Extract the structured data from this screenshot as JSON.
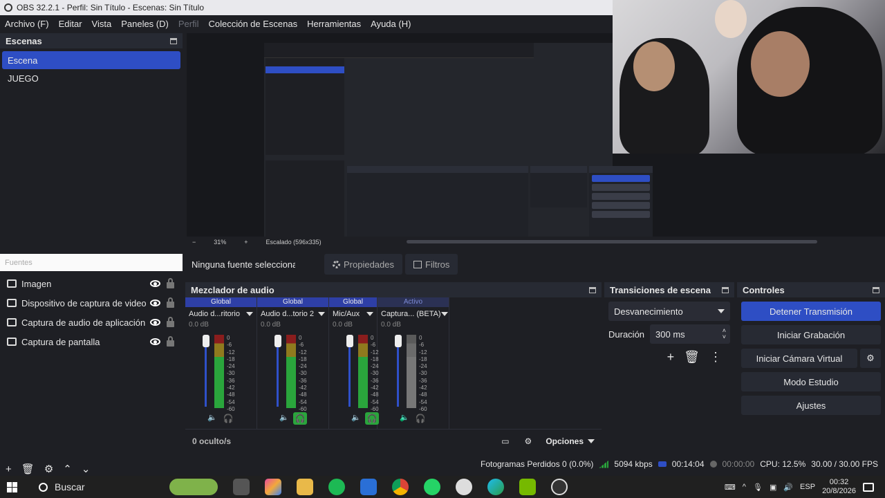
{
  "window": {
    "title": "OBS 32.2.1 - Perfil: Sin Título - Escenas: Sin Título"
  },
  "menu": [
    "Archivo (F)",
    "Editar",
    "Vista",
    "Paneles (D)",
    "Perfil",
    "Colección de Escenas",
    "Herramientas",
    "Ayuda (H)"
  ],
  "scenes": {
    "title": "Escenas",
    "items": [
      "Escena",
      "JUEGO"
    ],
    "selected": 0
  },
  "sources": {
    "title": "Fuentes",
    "items": [
      "Imagen",
      "Dispositivo de captura de video",
      "Captura de audio de aplicación",
      "Captura de pantalla"
    ]
  },
  "preview": {
    "zoom": "31%",
    "scale_label": "Escalado (596x335)"
  },
  "context": {
    "no_source": "Ninguna fuente seleccionada",
    "properties": "Propiedades",
    "filters": "Filtros"
  },
  "mixer": {
    "title": "Mezclador de audio",
    "channels": [
      {
        "header": "Global",
        "name": "Audio d...ritorio",
        "db": "0.0 dB",
        "monitor": false,
        "muted": false,
        "active": true
      },
      {
        "header": "Global",
        "name": "Audio d...torio 2",
        "db": "0.0 dB",
        "monitor": true,
        "muted": false,
        "active": true
      },
      {
        "header": "Global",
        "name": "Mic/Aux",
        "db": "0.0 dB",
        "monitor": true,
        "muted": false,
        "active": true
      },
      {
        "header": "Activo",
        "name": "Captura... (BETA)",
        "db": "0.0 dB",
        "monitor": false,
        "muted": true,
        "active": false
      }
    ],
    "scale": [
      "0",
      "-6",
      "-12",
      "-18",
      "-24",
      "-30",
      "-36",
      "-42",
      "-48",
      "-54",
      "-60"
    ],
    "hidden": "0 oculto/s",
    "options": "Opciones"
  },
  "transitions": {
    "title": "Transiciones de escena",
    "selected": "Desvanecimiento",
    "duration_label": "Duración",
    "duration_value": "300 ms"
  },
  "controls": {
    "title": "Controles",
    "stop_stream": "Detener Transmisión",
    "start_recording": "Iniciar Grabación",
    "virtual_cam": "Iniciar Cámara Virtual",
    "studio_mode": "Modo Estudio",
    "settings": "Ajustes"
  },
  "status": {
    "dropped": "Fotogramas Perdidos 0 (0.0%)",
    "bitrate": "5094 kbps",
    "live_time": "00:14:04",
    "rec_time": "00:00:00",
    "cpu": "CPU: 12.5%",
    "fps": "30.00 / 30.00 FPS"
  },
  "taskbar": {
    "search": "Buscar",
    "lang": "ESP",
    "time": "00:32",
    "date": "20/8/2026"
  },
  "colors": {
    "accent": "#2e4ec4",
    "meter_green": "#2aa53c",
    "bg": "#1e1f24"
  }
}
